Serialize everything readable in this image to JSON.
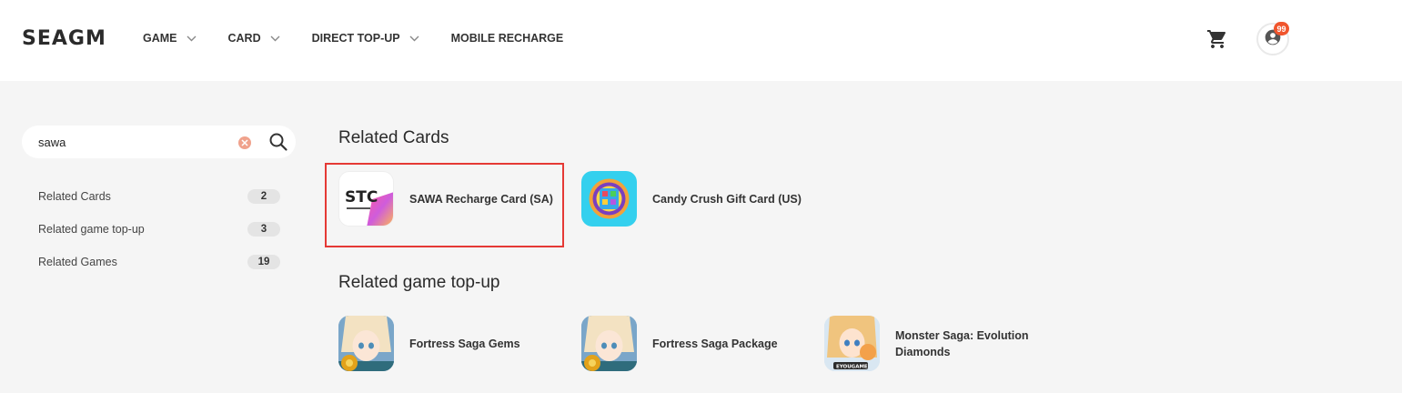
{
  "header": {
    "logo": "SEAGM",
    "nav": [
      {
        "label": "GAME",
        "has_dropdown": true
      },
      {
        "label": "CARD",
        "has_dropdown": true
      },
      {
        "label": "DIRECT TOP-UP",
        "has_dropdown": true
      },
      {
        "label": "MOBILE RECHARGE",
        "has_dropdown": false
      }
    ],
    "notification_count": "99"
  },
  "search": {
    "value": "sawa"
  },
  "sidebar": {
    "items": [
      {
        "label": "Related Cards",
        "count": "2"
      },
      {
        "label": "Related game top-up",
        "count": "3"
      },
      {
        "label": "Related Games",
        "count": "19"
      }
    ]
  },
  "main": {
    "related_cards": {
      "title": "Related Cards",
      "items": [
        {
          "label": "SAWA Recharge Card (SA)",
          "logo_text": "STC",
          "highlighted": true
        },
        {
          "label": "Candy Crush Gift Card (US)",
          "highlighted": false
        }
      ]
    },
    "related_topup": {
      "title": "Related game top-up",
      "items": [
        {
          "label": "Fortress Saga Gems"
        },
        {
          "label": "Fortress Saga Package"
        },
        {
          "label": "Monster Saga: Evolution Diamonds",
          "thumb_tag": "EYOUGAME"
        }
      ]
    }
  },
  "colors": {
    "accent": "#f0552d",
    "highlight_border": "#e53935",
    "page_background": "#f5f5f5"
  }
}
